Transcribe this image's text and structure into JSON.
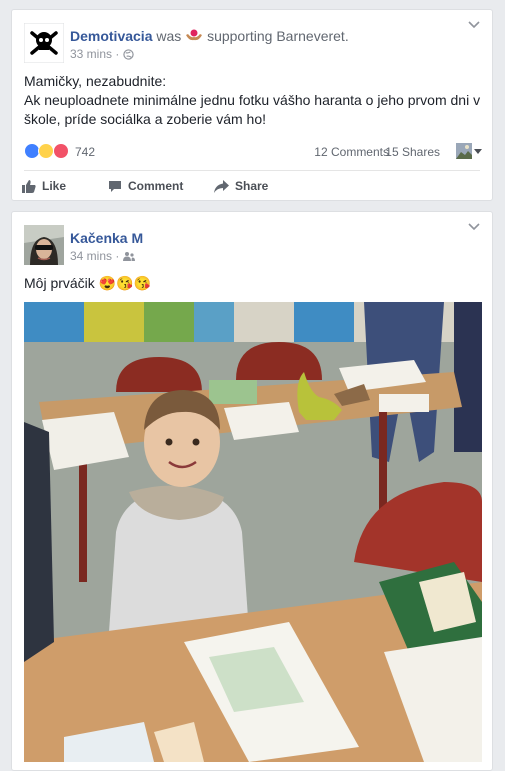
{
  "posts": [
    {
      "page_name": "Demotivacia",
      "activity_prefix": "was",
      "activity_text": "supporting Barneveret.",
      "time": "33 mins",
      "text_lines": [
        "Mamičky, nezabudnite:",
        "Ak neuploadnete minimálne jednu fotku vášho haranta o jeho prvom dni v",
        "škole, príde sociálka a zoberie vám ho!"
      ],
      "reaction_count": "742",
      "comments": "12 Comments",
      "shares": "15 Shares",
      "actions": [
        "Like",
        "Comment",
        "Share"
      ]
    },
    {
      "page_name": "Kačenka M",
      "time": "34 mins",
      "text": "Môj prváčik 😍😘😘"
    }
  ],
  "colors": {
    "background": "#e9ebee",
    "link": "#365899",
    "like_blue": "#4080ff",
    "love_red": "#f25268",
    "haha_yellow": "#ffd24b"
  }
}
